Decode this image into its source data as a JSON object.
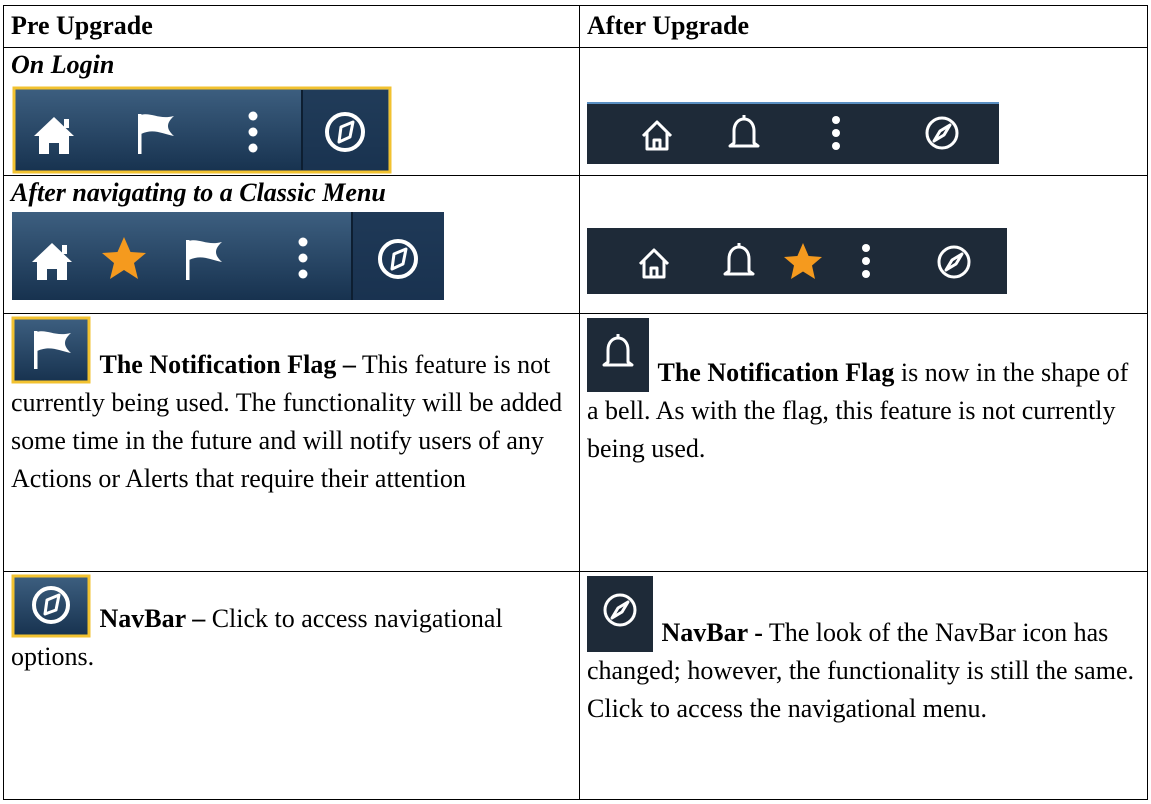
{
  "header": {
    "pre": "Pre Upgrade",
    "after": "After Upgrade"
  },
  "sections": {
    "on_login": "On Login",
    "after_classic": "After navigating to a Classic Menu"
  },
  "rows": {
    "flag": {
      "pre_title": "The Notification Flag –",
      "pre_text": " This feature is not currently being used. The functionality will be added some time in the future and will notify users of any Actions or Alerts that require their attention",
      "after_title": "The Notification Flag",
      "after_text": " is now in the shape of a bell.  As with the flag, this feature is not currently being used."
    },
    "navbar": {
      "pre_title": "NavBar –",
      "pre_text": " Click to access navigational options.",
      "after_title": "NavBar -",
      "after_text": " The look of the NavBar icon has changed; however, the functionality is still the same.  Click to access the navigational menu."
    }
  },
  "icons": {
    "pre_bar_login": [
      "home-icon",
      "flag-icon",
      "more-vertical-icon",
      "compass-icon"
    ],
    "after_bar_login": [
      "home-icon",
      "bell-icon",
      "more-vertical-icon",
      "compass-icon"
    ],
    "pre_bar_classic": [
      "home-icon",
      "star-icon",
      "flag-icon",
      "more-vertical-icon",
      "compass-icon"
    ],
    "after_bar_classic": [
      "home-icon",
      "bell-icon",
      "star-icon",
      "more-vertical-icon",
      "compass-icon"
    ]
  },
  "colors": {
    "old_bar_top": "#3d5f80",
    "old_bar_bottom": "#17324f",
    "new_bar": "#1e2a38",
    "highlight_border": "#f2c230",
    "star": "#f59a1e"
  }
}
